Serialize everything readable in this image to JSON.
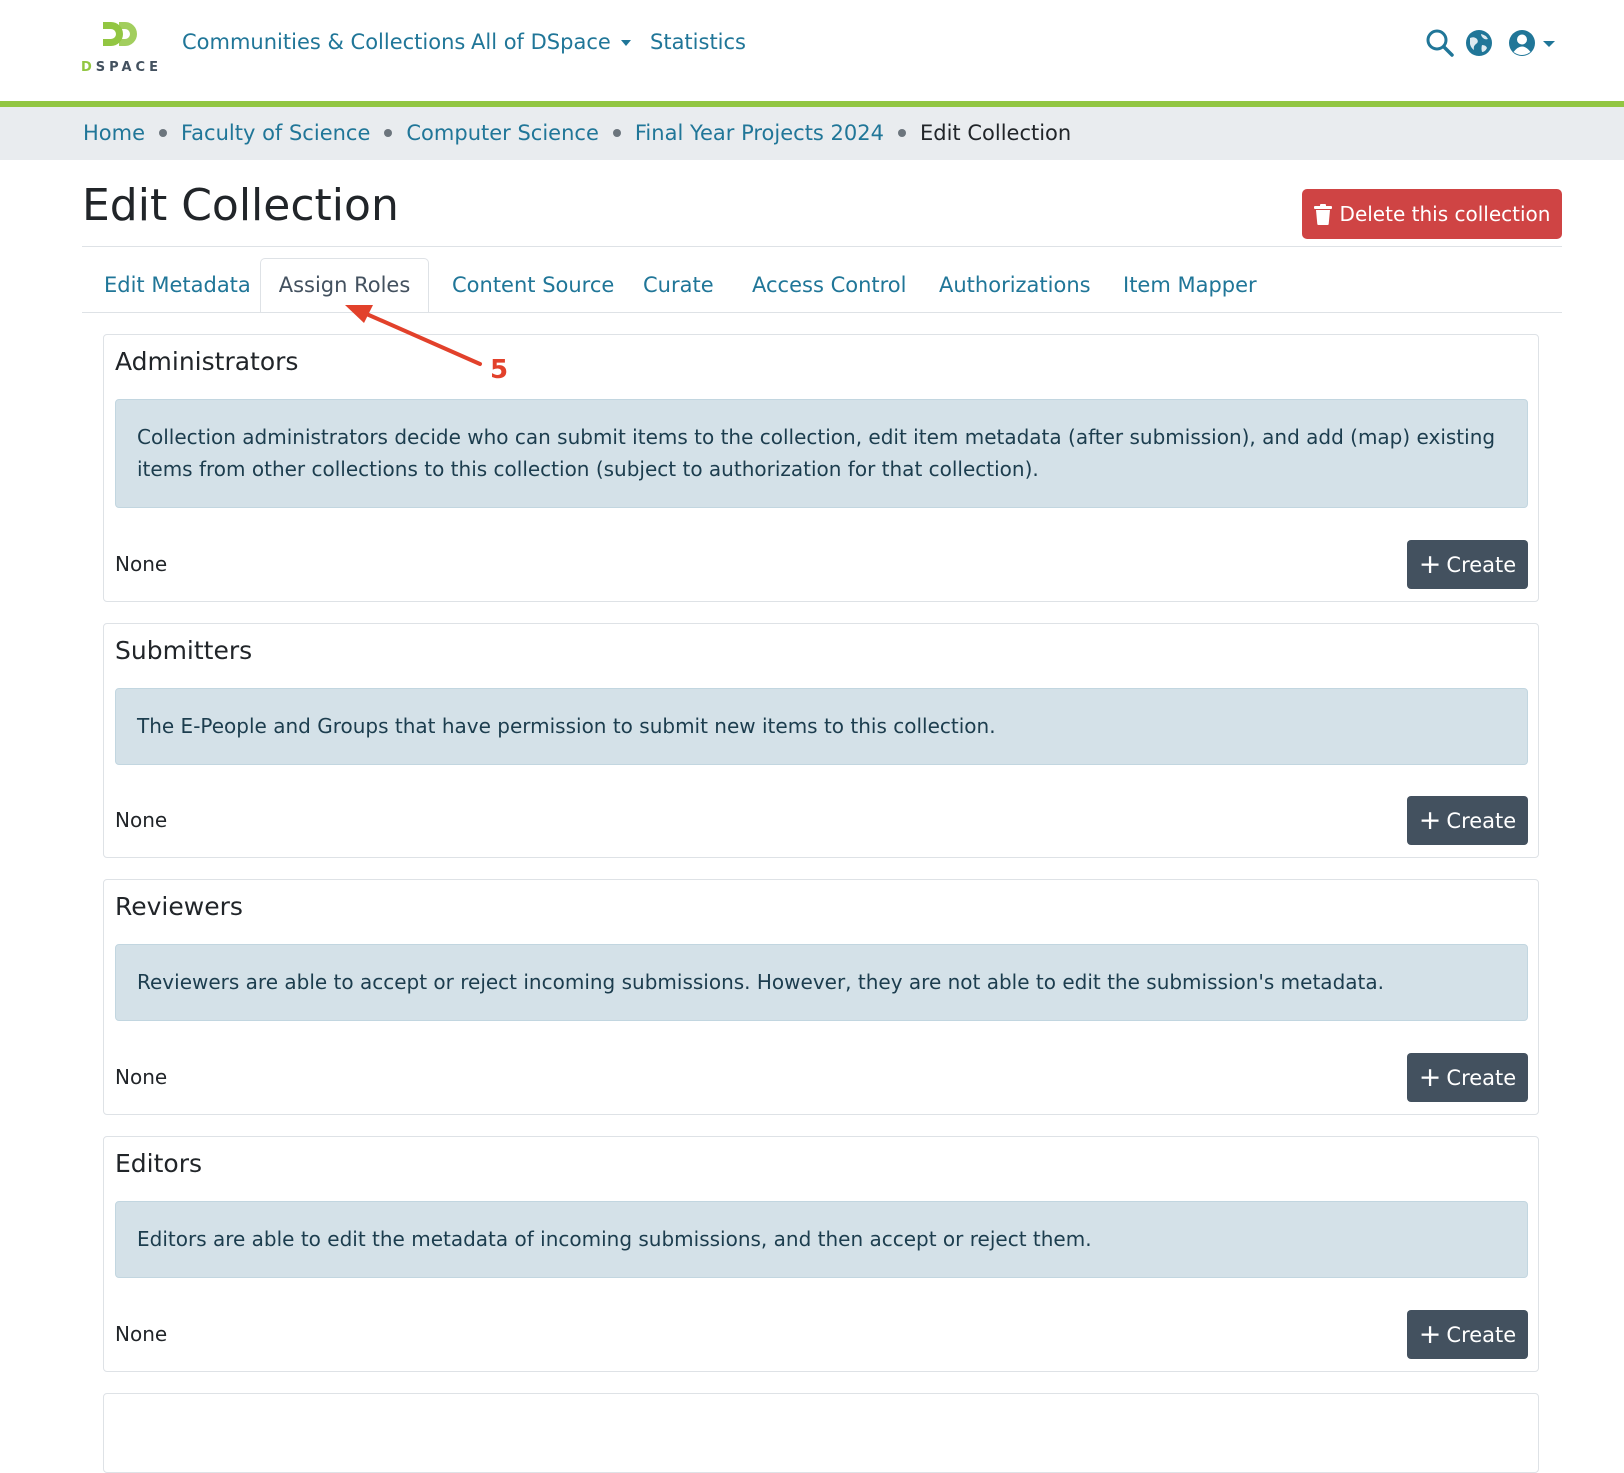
{
  "nav": {
    "logo_text": "DSPACE",
    "links": [
      "Communities & Collections",
      "All of DSpace",
      "Statistics"
    ],
    "icons": [
      "search-icon",
      "globe-icon",
      "user-circle-icon"
    ]
  },
  "breadcrumb": {
    "items": [
      "Home",
      "Faculty of Science",
      "Computer Science",
      "Final Year Projects 2024"
    ],
    "active": "Edit Collection"
  },
  "page": {
    "title": "Edit Collection",
    "delete_label": "Delete this collection"
  },
  "tabs": [
    "Edit Metadata",
    "Assign Roles",
    "Content Source",
    "Curate",
    "Access Control",
    "Authorizations",
    "Item Mapper"
  ],
  "active_tab": "Assign Roles",
  "roles": [
    {
      "title": "Administrators",
      "description": "Collection administrators decide who can submit items to the collection, edit item metadata (after submission), and add (map) existing items from other collections to this collection (subject to authorization for that collection).",
      "value": "None",
      "button": "Create"
    },
    {
      "title": "Submitters",
      "description": "The E-People and Groups that have permission to submit new items to this collection.",
      "value": "None",
      "button": "Create"
    },
    {
      "title": "Reviewers",
      "description": "Reviewers are able to accept or reject incoming submissions. However, they are not able to edit the submission's metadata.",
      "value": "None",
      "button": "Create"
    },
    {
      "title": "Editors",
      "description": "Editors are able to edit the metadata of incoming submissions, and then accept or reject them.",
      "value": "None",
      "button": "Create"
    }
  ],
  "annotation": {
    "label": "5"
  },
  "colors": {
    "link": "#207698",
    "accent_bar": "#92c642",
    "danger": "#cf4444",
    "dark_button": "#43515f",
    "info_bg": "#d4e1e8",
    "annotation": "#e2412b"
  }
}
